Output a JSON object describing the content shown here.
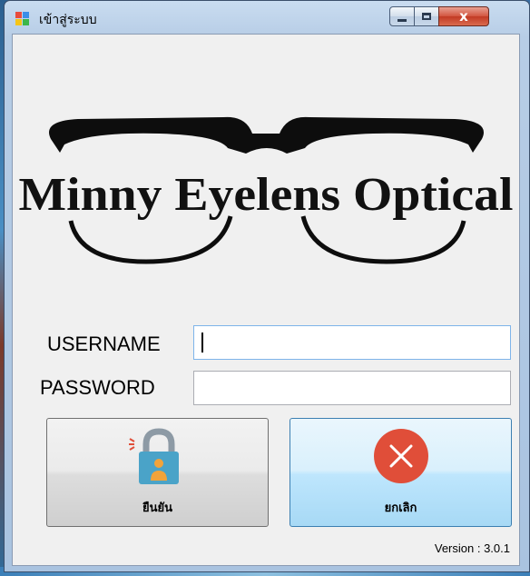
{
  "window": {
    "title": "เข้าสู่ระบบ",
    "controls": {
      "minimize": "minimize",
      "maximize": "maximize",
      "close": "x"
    }
  },
  "logo": {
    "text": "Minny Eyelens Optical"
  },
  "form": {
    "username_label": "USERNAME",
    "username_value": "",
    "password_label": "PASSWORD",
    "password_value": ""
  },
  "buttons": {
    "confirm_label": "ยืนยัน",
    "cancel_label": "ยกเลิก"
  },
  "icons": {
    "app": "app-window-icon",
    "confirm": "lock-user-icon",
    "cancel": "red-x-circle-icon"
  },
  "colors": {
    "cancel_red": "#e04e39",
    "lock_teal": "#4aa3c8",
    "user_orange": "#f2a33a"
  },
  "version": "Version : 3.0.1"
}
